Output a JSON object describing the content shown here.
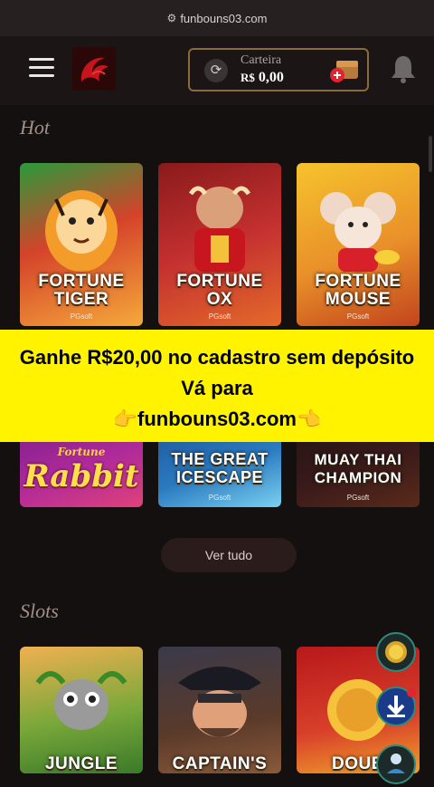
{
  "browser": {
    "url": "funbouns03.com"
  },
  "header": {
    "wallet_label": "Carteira",
    "currency": "R$",
    "balance": "0,00"
  },
  "sections": {
    "hot_title": "Hot",
    "slots_title": "Slots"
  },
  "hot_games": [
    {
      "line1": "FORTUNE",
      "line2": "TIGER",
      "studio": "PGsoft"
    },
    {
      "line1": "FORTUNE",
      "line2": "OX",
      "studio": "PGsoft"
    },
    {
      "line1": "FORTUNE",
      "line2": "MOUSE",
      "studio": "PGsoft"
    },
    {
      "line1": "Fortune",
      "line2": "Rabbit",
      "studio": ""
    },
    {
      "line1": "THE GREAT",
      "line2": "ICESCAPE",
      "studio": "PGsoft"
    },
    {
      "line1": "MUAY THAI",
      "line2": "CHAMPION",
      "studio": "PGsoft"
    }
  ],
  "see_all": "Ver tudo",
  "slot_games": [
    {
      "title": "JUNGLE"
    },
    {
      "title": "CAPTAIN'S"
    },
    {
      "title": "DOUB"
    }
  ],
  "promo": {
    "line1": "Ganhe R$20,00 no cadastro sem depósito",
    "line2": "Vá para",
    "line3": "👉funbouns03.com👈"
  },
  "colors": {
    "background": "#151010",
    "accent_gold": "#8a6b3c",
    "promo_yellow": "#fff300"
  }
}
